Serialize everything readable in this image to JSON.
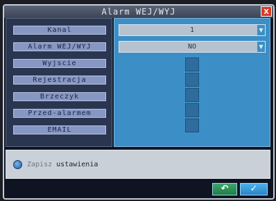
{
  "window": {
    "title": "Alarm WEJ/WYJ",
    "close_label": "X"
  },
  "menu": {
    "items": [
      {
        "label": "Kanal"
      },
      {
        "label": "Alarm WEJ/WYJ"
      },
      {
        "label": "Wyjscie"
      },
      {
        "label": "Rejestracja"
      },
      {
        "label": "Brzeczyk"
      },
      {
        "label": "Przed-alarmem"
      },
      {
        "label": "EMAIL"
      }
    ]
  },
  "settings": {
    "kanal": {
      "value": "1"
    },
    "alarm": {
      "value": "NO"
    },
    "wyjscie": {
      "checked": false
    },
    "rejestracja": {
      "checked": false
    },
    "brzeczyk": {
      "checked": false
    },
    "przed_alarmem": {
      "checked": false
    },
    "email": {
      "checked": false
    }
  },
  "hint": {
    "prefix": "Zapisz",
    "text": "ustawienia"
  },
  "icons": {
    "hint": "info-icon",
    "back": "back-arrow-icon",
    "ok": "checkmark-icon",
    "dropdown": "chevron-down-icon"
  },
  "footer": {
    "back_label": "↶",
    "ok_label": "✓"
  }
}
